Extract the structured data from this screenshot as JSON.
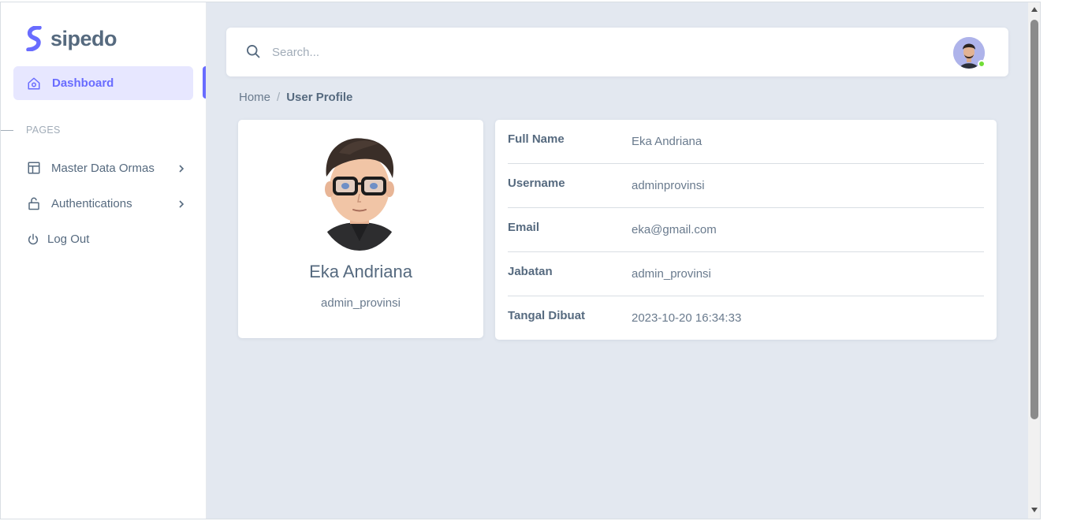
{
  "app": {
    "brand_name": "sipedo",
    "brand_color": "#696cff"
  },
  "sidebar": {
    "active_item": {
      "label": "Dashboard",
      "icon": "home-icon"
    },
    "section_title": "PAGES",
    "items": [
      {
        "label": "Master Data Ormas",
        "icon": "layout-icon",
        "has_submenu": true
      },
      {
        "label": "Authentications",
        "icon": "lock-icon",
        "has_submenu": true
      },
      {
        "label": "Log Out",
        "icon": "power-icon",
        "has_submenu": false
      }
    ]
  },
  "header": {
    "search_placeholder": "Search...",
    "user_status": "online"
  },
  "breadcrumb": {
    "home": "Home",
    "separator": "/",
    "current": "User Profile"
  },
  "profile": {
    "name": "Eka Andriana",
    "role": "admin_provinsi"
  },
  "details": [
    {
      "label": "Full Name",
      "value": "Eka Andriana"
    },
    {
      "label": "Username",
      "value": "adminprovinsi"
    },
    {
      "label": "Email",
      "value": "eka@gmail.com"
    },
    {
      "label": "Jabatan",
      "value": "admin_provinsi"
    },
    {
      "label": "Tangal Dibuat",
      "value": "2023-10-20 16:34:33"
    }
  ]
}
